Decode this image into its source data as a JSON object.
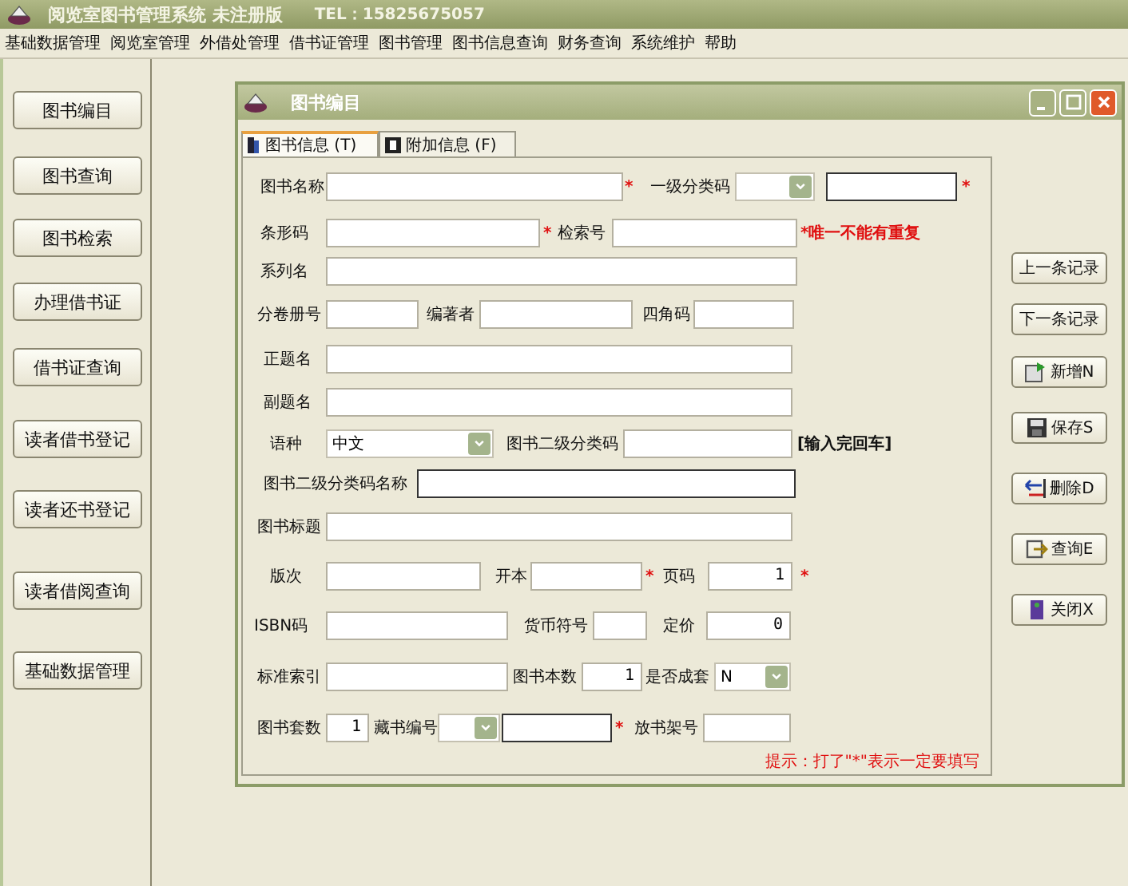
{
  "window": {
    "title": "阅览室图书管理系统 未注册版",
    "phone": "TEL：15825675057"
  },
  "menu": [
    "基础数据管理",
    "阅览室管理",
    "外借处管理",
    "借书证管理",
    "图书管理",
    "图书信息查询",
    "财务查询",
    "系统维护",
    "帮助"
  ],
  "sidebar": {
    "buttons": [
      "图书编目",
      "图书查询",
      "图书检索",
      "办理借书证",
      "借书证查询",
      "读者借书登记",
      "读者还书登记",
      "读者借阅查询",
      "基础数据管理"
    ]
  },
  "child_window": {
    "title": "图书编目",
    "tabs": [
      {
        "label": "图书信息 (T)",
        "selected": true
      },
      {
        "label": "附加信息 (F)",
        "selected": false
      }
    ],
    "rows": [
      {
        "items": [
          {
            "kind": "label",
            "text": "图书名称"
          },
          {
            "kind": "field",
            "highlighted": false
          },
          {
            "kind": "star",
            "text": "*"
          },
          {
            "kind": "label",
            "text": "一级分类码"
          },
          {
            "kind": "combo"
          },
          {
            "kind": "field",
            "highlighted": true
          },
          {
            "kind": "star",
            "text": "*"
          }
        ]
      },
      {
        "items": [
          {
            "kind": "label",
            "text": "条形码"
          },
          {
            "kind": "field",
            "highlighted": false
          },
          {
            "kind": "star",
            "text": "*"
          },
          {
            "kind": "label",
            "text": "检索号"
          },
          {
            "kind": "field",
            "highlighted": false
          },
          {
            "kind": "warning",
            "text": "*唯一不能有重复"
          }
        ]
      },
      {
        "items": [
          {
            "kind": "label",
            "text": "系列名"
          },
          {
            "kind": "field",
            "highlighted": false
          }
        ]
      },
      {
        "items": [
          {
            "kind": "label",
            "text": "分卷册号"
          },
          {
            "kind": "field",
            "highlighted": false
          },
          {
            "kind": "label",
            "text": "编著者"
          },
          {
            "kind": "field",
            "highlighted": false
          },
          {
            "kind": "label",
            "text": "四角码"
          },
          {
            "kind": "field",
            "highlighted": false
          }
        ]
      },
      {
        "items": [
          {
            "kind": "label",
            "text": "正题名"
          },
          {
            "kind": "field",
            "highlighted": false
          }
        ]
      },
      {
        "items": [
          {
            "kind": "label",
            "text": "副题名"
          },
          {
            "kind": "field",
            "highlighted": false
          }
        ]
      },
      {
        "items": [
          {
            "kind": "label",
            "text": "语种"
          },
          {
            "kind": "combo",
            "value": "中文"
          },
          {
            "kind": "label",
            "text": "图书二级分类码"
          },
          {
            "kind": "field",
            "highlighted": false
          },
          {
            "kind": "note",
            "text": "[输入完回车]"
          }
        ]
      },
      {
        "items": [
          {
            "kind": "label",
            "text": "图书二级分类码名称"
          },
          {
            "kind": "field",
            "highlighted": true
          }
        ]
      },
      {
        "items": [
          {
            "kind": "label",
            "text": "图书标题"
          },
          {
            "kind": "field",
            "highlighted": false
          }
        ]
      },
      {
        "items": [
          {
            "kind": "label",
            "text": "版次"
          },
          {
            "kind": "field",
            "highlighted": false
          },
          {
            "kind": "label",
            "text": "开本"
          },
          {
            "kind": "field",
            "highlighted": false
          },
          {
            "kind": "star",
            "text": "*"
          },
          {
            "kind": "label",
            "text": "页码"
          },
          {
            "kind": "field",
            "highlighted": false,
            "value": "1"
          },
          {
            "kind": "star",
            "text": "*"
          }
        ]
      },
      {
        "items": [
          {
            "kind": "label",
            "text": "ISBN码"
          },
          {
            "kind": "field",
            "highlighted": false
          },
          {
            "kind": "label",
            "text": "货币符号"
          },
          {
            "kind": "field",
            "highlighted": false
          },
          {
            "kind": "label",
            "text": "定价"
          },
          {
            "kind": "field",
            "highlighted": false,
            "value": "0"
          }
        ]
      },
      {
        "items": [
          {
            "kind": "label",
            "text": "标准索引"
          },
          {
            "kind": "field",
            "highlighted": false
          },
          {
            "kind": "label",
            "text": "图书本数"
          },
          {
            "kind": "field",
            "highlighted": false,
            "value": "1"
          },
          {
            "kind": "label",
            "text": "是否成套"
          },
          {
            "kind": "combo",
            "value": "N"
          }
        ]
      },
      {
        "items": [
          {
            "kind": "label",
            "text": "图书套数"
          },
          {
            "kind": "field",
            "highlighted": false,
            "value": "1"
          },
          {
            "kind": "label",
            "text": "藏书编号"
          },
          {
            "kind": "combo"
          },
          {
            "kind": "field",
            "highlighted": true
          },
          {
            "kind": "star",
            "text": "*"
          },
          {
            "kind": "label",
            "text": "放书架号"
          },
          {
            "kind": "field",
            "highlighted": false
          }
        ]
      }
    ],
    "hint": "提示：打了\"*\"表示一定要填写",
    "buttons": [
      {
        "label": "上一条记录",
        "kind": "text"
      },
      {
        "label": "下一条记录",
        "kind": "text"
      },
      {
        "label": "新增N",
        "kind": "add"
      },
      {
        "label": "保存S",
        "kind": "save"
      },
      {
        "label": "删除D",
        "kind": "delete"
      },
      {
        "label": "查询E",
        "kind": "query"
      },
      {
        "label": "关闭X",
        "kind": "close"
      }
    ]
  }
}
